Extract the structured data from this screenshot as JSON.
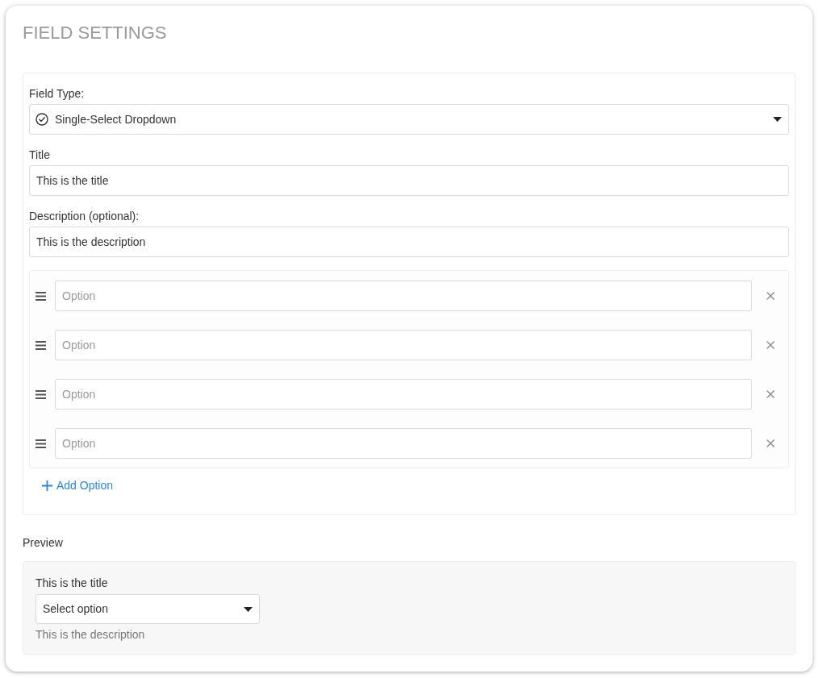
{
  "panel": {
    "title": "FIELD SETTINGS"
  },
  "field_type": {
    "label": "Field Type:",
    "value": "Single-Select Dropdown"
  },
  "title_field": {
    "label": "Title",
    "value": "This is the title"
  },
  "description_field": {
    "label": "Description (optional):",
    "value": "This is the description"
  },
  "options": [
    {
      "placeholder": "Option"
    },
    {
      "placeholder": "Option"
    },
    {
      "placeholder": "Option"
    },
    {
      "placeholder": "Option"
    }
  ],
  "add_option": {
    "label": "Add Option"
  },
  "preview": {
    "heading": "Preview",
    "title": "This is the title",
    "select": {
      "value": "Select option"
    },
    "description": "This is the description"
  }
}
